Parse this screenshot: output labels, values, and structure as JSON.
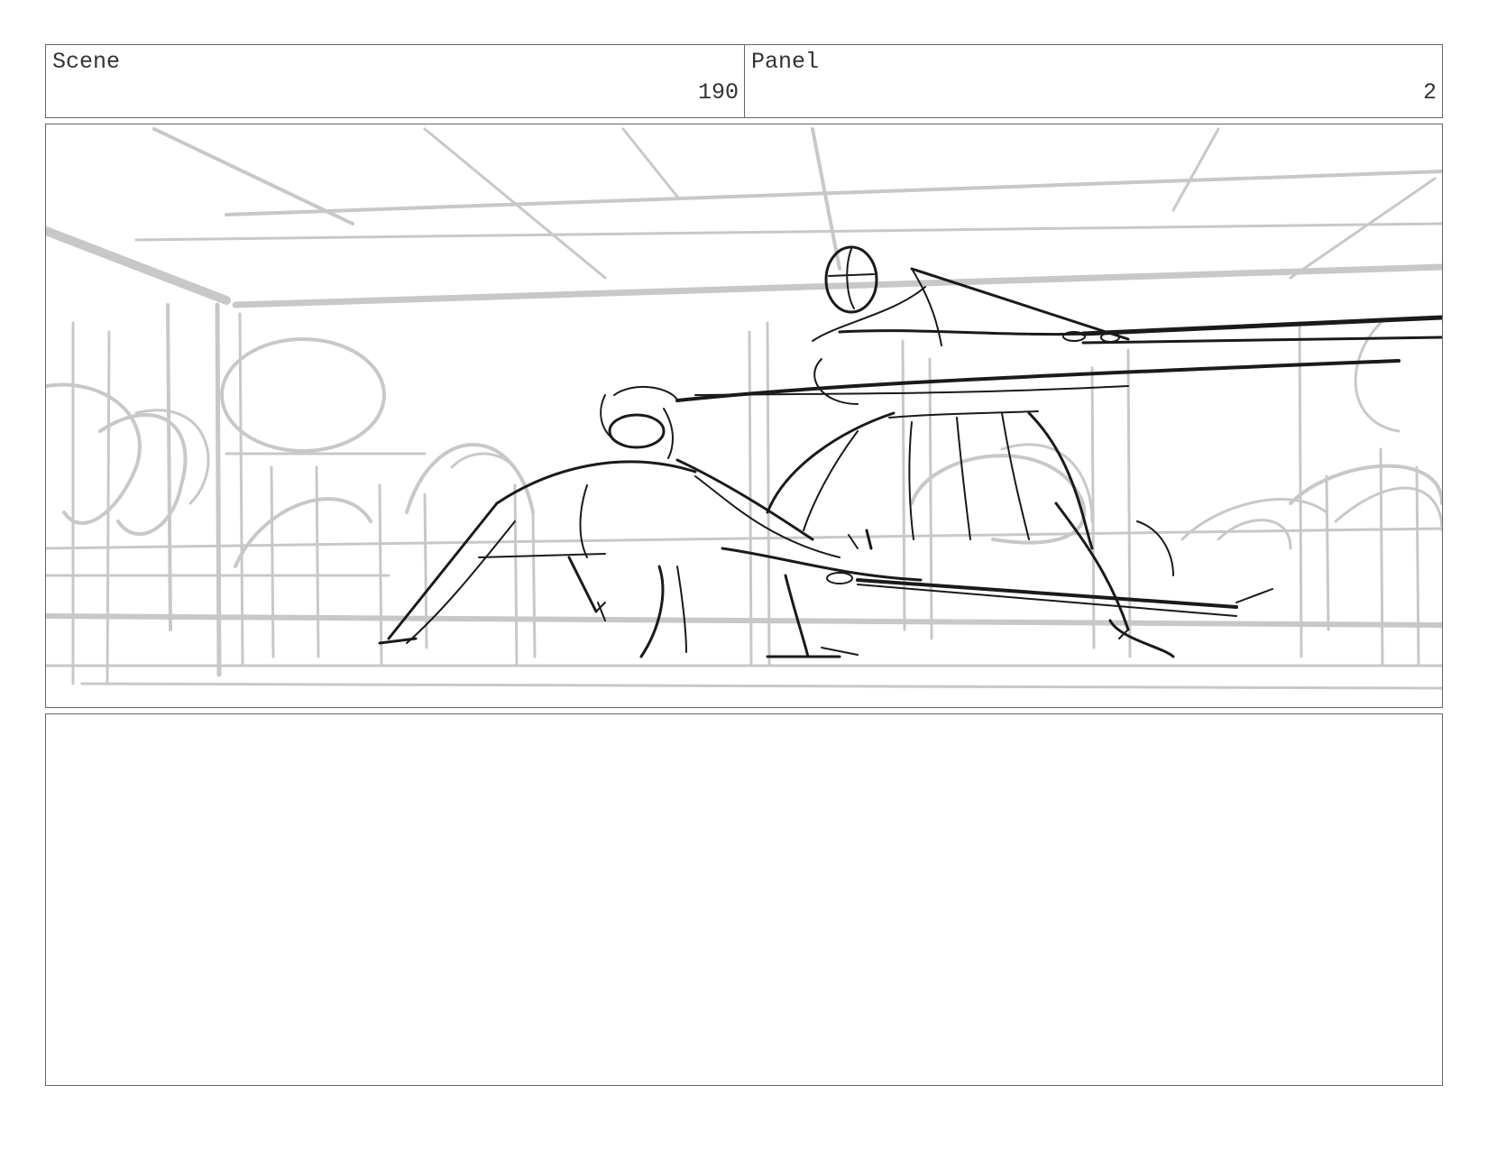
{
  "header": {
    "scene_label": "Scene",
    "scene_number": "190",
    "panel_label": "Panel",
    "panel_number": "2"
  },
  "frame": {
    "icon": "storyboard-sketch",
    "colors": {
      "background_lines": "#c8c8c8",
      "figure_lines": "#1a1a1a"
    }
  },
  "notes": {
    "text": ""
  }
}
